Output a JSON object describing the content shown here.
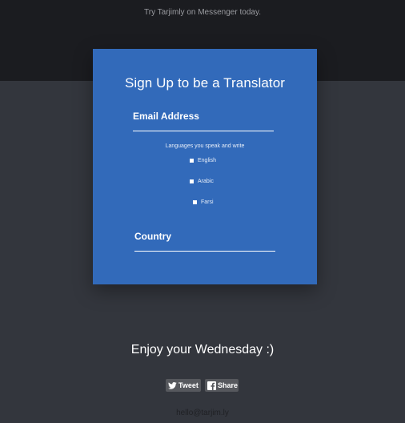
{
  "promo": {
    "text": "Try Tarjimly on Messenger today."
  },
  "signup": {
    "title": "Sign Up to be a Translator",
    "email_placeholder": "Email Address",
    "languages_label": "Languages you speak and write",
    "languages": [
      {
        "label": "English",
        "checked": false
      },
      {
        "label": "Arabic",
        "checked": false
      },
      {
        "label": "Farsi",
        "checked": false
      }
    ],
    "country_placeholder": "Country"
  },
  "footer": {
    "greeting": "Enjoy your Wednesday :)",
    "tweet_label": "Tweet",
    "share_label": "Share",
    "contact_email": "hello@tarjim.ly"
  },
  "colors": {
    "top_band": "#1b1c20",
    "background": "#33363d",
    "card": "#326aba",
    "share_button": "#56585d"
  },
  "icons": {
    "tweet": "twitter-bird-icon",
    "share": "facebook-f-icon",
    "checkbox": "checkbox-icon"
  }
}
